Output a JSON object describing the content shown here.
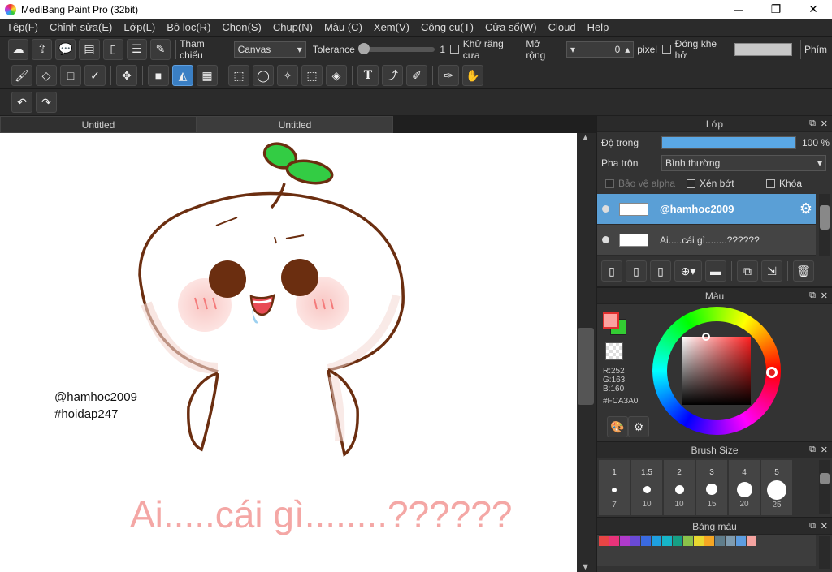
{
  "window": {
    "title": "MediBang Paint Pro (32bit)",
    "min": "─",
    "max": "❐",
    "close": "✕"
  },
  "menu": [
    "Tệp(F)",
    "Chỉnh sửa(E)",
    "Lớp(L)",
    "Bộ lọc(R)",
    "Chọn(S)",
    "Chụp(N)",
    "Màu (C)",
    "Xem(V)",
    "Công cụ(T)",
    "Cửa sổ(W)",
    "Cloud",
    "Help"
  ],
  "toolbar1": {
    "ref_label": "Tham chiếu",
    "ref_value": "Canvas",
    "tolerance_label": "Tolerance",
    "tolerance_value": "1",
    "antialias_label": "Khử răng cưa",
    "expand_label": "Mở rộng",
    "expand_value": "0",
    "expand_unit": "pixel",
    "close_gap_label": "Đóng khe hở",
    "keys_label": "Phím"
  },
  "tabs": [
    "Untitled",
    "Untitled"
  ],
  "canvas": {
    "watermark1": "@hamhoc2009",
    "watermark2": "#hoidap247",
    "caption": "Ai.....cái gì........??????"
  },
  "layer_panel": {
    "title": "Lớp",
    "opacity_label": "Độ trong",
    "opacity_value": "100 %",
    "opacity_fraction": 1.0,
    "blend_label": "Pha trộn",
    "blend_value": "Bình thường",
    "protect_alpha": "Bảo vệ alpha",
    "clip": "Xén bớt",
    "lock": "Khóa",
    "layers": [
      {
        "name": "@hamhoc2009",
        "selected": true
      },
      {
        "name": "Ai.....cái gì........??????",
        "selected": false
      }
    ]
  },
  "color_panel": {
    "title": "Màu",
    "r": "R:252",
    "g": "G:163",
    "b": "B:160",
    "hex": "#FCA3A0",
    "primary": "#FCA3A0",
    "secondary": "#33cc33"
  },
  "brush_panel": {
    "title": "Brush Size",
    "sizes": [
      "1",
      "1.5",
      "2",
      "3",
      "4",
      "5"
    ],
    "bottom_sizes": [
      "7",
      "10",
      "10",
      "15",
      "20",
      "25"
    ]
  },
  "palette_panel": {
    "title": "Bảng màu",
    "colors": [
      "#e84545",
      "#e8337a",
      "#b03acb",
      "#6a4ad6",
      "#3a6ae0",
      "#1ea0e0",
      "#16b5c8",
      "#16a085",
      "#8bc34a",
      "#e8d830",
      "#f5a623",
      "#607d8b",
      "#7f9cb0",
      "#5d9de0",
      "#f4a3a0"
    ]
  }
}
